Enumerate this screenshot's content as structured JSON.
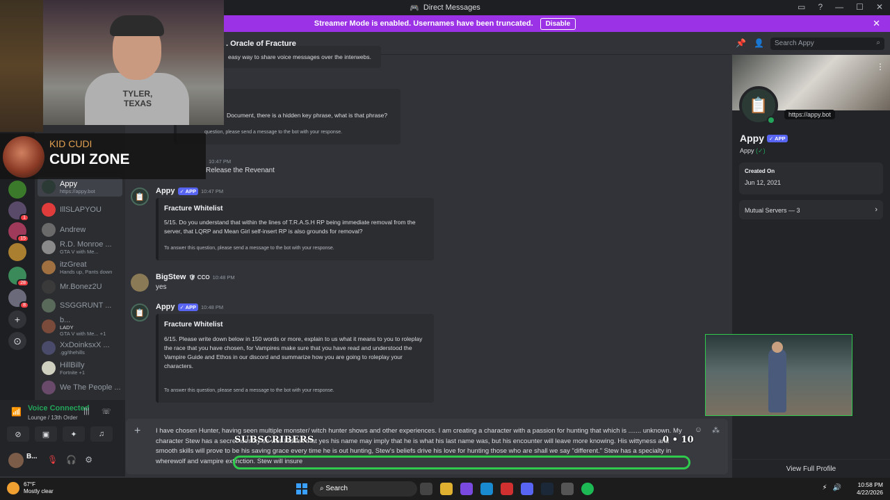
{
  "window": {
    "title": "Direct Messages",
    "buttons": [
      "▭",
      "?",
      "—",
      "☐",
      "✕"
    ]
  },
  "banner": {
    "text": "Streamer Mode is enabled. Usernames have been truncated.",
    "disable_label": "Disable"
  },
  "chat_header": {
    "name": ", Oracle of Fracture",
    "search_placeholder": "Search Appy"
  },
  "rail_badges": [
    "1",
    "15",
    "28",
    "8"
  ],
  "dm_list": [
    {
      "name": "Appy",
      "sub": "https://appy.bot",
      "color": "#2c3a35",
      "active": true
    },
    {
      "name": "IllSLAPYOU",
      "sub": "",
      "color": "#e03c3c"
    },
    {
      "name": "Andrew",
      "sub": "",
      "color": "#6a6a6a"
    },
    {
      "name": "R.D. Monroe ...",
      "sub": "GTA V with Me...",
      "color": "#8a8a8a"
    },
    {
      "name": "itzGreat",
      "sub": "Hands up, Pants down",
      "color": "#a07040"
    },
    {
      "name": "Mr.Bonez2U",
      "sub": "",
      "color": "#3a3a3a"
    },
    {
      "name": "SSGGRUNT ...",
      "sub": "",
      "color": "#5a6a5a"
    },
    {
      "name": "b...",
      "sub": "GTA V with Me... +1",
      "color": "#7a4a3a",
      "tag": "LADY"
    },
    {
      "name": "XxDoinksxX ...",
      "sub": ".gg/thehills",
      "color": "#4a4a6a"
    },
    {
      "name": "HillBilly",
      "sub": "Fortnite +1",
      "color": "#d0d0c0"
    },
    {
      "name": "We The People ...",
      "sub": "",
      "color": "#6a4a6a"
    }
  ],
  "voice": {
    "title": "Voice Connected",
    "subtitle": "Lounge / 13th Order"
  },
  "user": {
    "name": "B..."
  },
  "messages": {
    "top_snippet": "easy way to share voice messages over the interwebs.",
    "q_doc": "Document, there is a hidden key phrase, what is that phrase?",
    "q_doc_footer": "question, please send a message to the bot with your response.",
    "time_1047a": "10:47 PM",
    "revenant": "Release the Revenant",
    "m1": {
      "name": "Appy",
      "tag": "APP",
      "time": "10:47 PM",
      "embed_title": "Fracture Whitelist",
      "embed_body": "5/15. Do you understand that within the lines of T.R.A.S.H RP being immediate removal from the server, that LQRP and Mean Girl self-insert RP is also grounds for removal?",
      "embed_footer": "To answer this question, please send a message to the bot with your response."
    },
    "m2": {
      "name": "BigStew",
      "tag": "CCO",
      "time": "10:48 PM",
      "text": "yes"
    },
    "m3": {
      "name": "Appy",
      "tag": "APP",
      "time": "10:48 PM",
      "embed_title": "Fracture Whitelist",
      "embed_body": "6/15. Please write down below in 150 words or more, explain to us what it means to you to roleplay the race that you have chosen, for Vampires make sure that you have read and understood the Vampire Guide and Ethos in our discord and summarize how you are going to roleplay your characters.",
      "embed_footer": "To answer this question, please send a message to the bot with your response."
    }
  },
  "composer": {
    "text": "I have chosen Hunter, having seen multiple monster/ witch hunter shows and other experiences. I am creating a character with a passion for hunting that which is ....... unknown. My character Stew has a secret identity so well hidden that yes his name may imply that he is what his last name was, but his encounter will leave more knowing. His wittyness and smooth skills will prove to be his saving grace every time he is out hunting, Stew's beliefs drive his love for hunting those who are shall we say \"different.\" Stew has a specialty in wherewolf and vampire extinction. Stew will insure"
  },
  "profile": {
    "url": "https://appy.bot",
    "name": "Appy",
    "tag": "APP",
    "username": "Appy",
    "created_label": "Created On",
    "created_value": "Jun 12, 2021",
    "mutual": "Mutual Servers — 3",
    "view_full": "View Full Profile"
  },
  "overlay": {
    "artist": "KID CUDI",
    "song": "CUDI ZONE",
    "shirt": "TYLER, TEXAS",
    "subs_label": "SUBSCRIBERS",
    "subs_count": "0 • 10"
  },
  "taskbar": {
    "temp": "67°F",
    "weather": "Mostly clear",
    "search": "Search",
    "time": "10:58 PM",
    "date": "4/22/2026"
  }
}
